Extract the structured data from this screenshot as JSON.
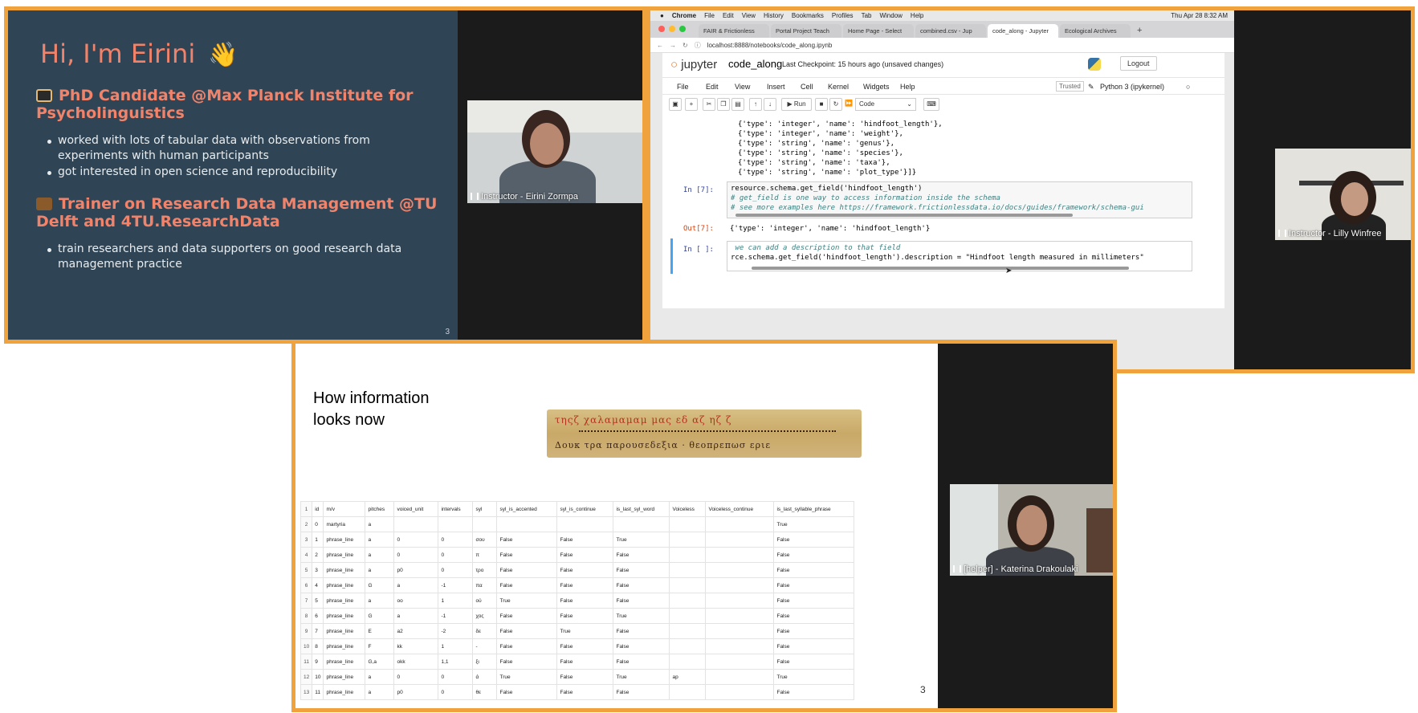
{
  "panel1": {
    "greeting": "Hi, I'm Eirini",
    "wave_emoji": "👋",
    "heading1": "PhD Candidate @Max Planck Institute for Psycholinguistics",
    "bullets1": [
      "worked with lots of tabular data with observations from experiments with human participants",
      "got interested in open science and reproducibility"
    ],
    "heading2": "Trainer on Research Data Management @TU Delft and 4TU.ResearchData",
    "bullets2": [
      "train researchers and data supporters on good research data management practice"
    ],
    "slide_number": "3",
    "video_label": "Instructor - Eirini Zormpa"
  },
  "panel2": {
    "mac_menu": [
      "Chrome",
      "File",
      "Edit",
      "View",
      "History",
      "Bookmarks",
      "Profiles",
      "Tab",
      "Window",
      "Help"
    ],
    "clock": "Thu Apr 28  8:32 AM",
    "tabs": [
      "FAIR & Frictionless",
      "Portal Project Teach",
      "Home Page - Select",
      "combined.csv - Jup",
      "code_along - Jupyter",
      "Ecological Archives"
    ],
    "active_tab": 4,
    "url": "localhost:8888/notebooks/code_along.ipynb",
    "jupyter_logo": "jupyter",
    "notebook_name": "code_along",
    "checkpoint": "Last Checkpoint: 15 hours ago  (unsaved changes)",
    "logout": "Logout",
    "menus": [
      "File",
      "Edit",
      "View",
      "Insert",
      "Cell",
      "Kernel",
      "Widgets",
      "Help"
    ],
    "trusted": "Trusted",
    "kernel": "Python 3 (ipykernel)",
    "run_label": "Run",
    "cell_type": "Code",
    "schema_lines": [
      "{'type': 'integer', 'name': 'hindfoot_length'},",
      "{'type': 'integer', 'name': 'weight'},",
      "{'type': 'string', 'name': 'genus'},",
      "{'type': 'string', 'name': 'species'},",
      "{'type': 'string', 'name': 'taxa'},",
      "{'type': 'string', 'name': 'plot_type'}]}"
    ],
    "in7_prompt": "In [7]:",
    "in7_code": "resource.schema.get_field('hindfoot_length')",
    "in7_comment1": "# get_field is one way to access information inside the schema",
    "in7_comment2": "# see more examples here https://framework.frictionlessdata.io/docs/guides/framework/schema-gui",
    "out7_prompt": "Out[7]:",
    "out7_value": "{'type': 'integer', 'name': 'hindfoot_length'}",
    "in_empty_prompt": "In [ ]:",
    "in_empty_comment": " we can add a description to that field",
    "in_empty_code": "rce.schema.get_field('hindfoot_length').description = \"Hindfoot length measured in millimeters\"",
    "video_label": "Instructor - Lilly Winfree"
  },
  "panel3": {
    "title_line1": "How information",
    "title_line2": "looks now",
    "manuscript_line1": "τηςζ χαλαμαμαμ μας  εδ αζ  ηζ ζ",
    "manuscript_line2": "Δουκ τρα παρουσεδεξια · θεοπρεπωσ εριε",
    "table_headers": [
      "",
      "id",
      "m/v",
      "pitches",
      "voiced_unit",
      "intervals",
      "syl",
      "syl_is_accented",
      "syl_is_continue",
      "is_last_syl_word",
      "Voiceless",
      "Voiceless_continue",
      "is_last_syllable_phrase"
    ],
    "table_rows": [
      [
        "2",
        "0",
        "martyria",
        "a",
        "",
        "",
        "",
        "",
        "",
        "",
        "",
        "",
        "True"
      ],
      [
        "3",
        "1",
        "phrase_line",
        "a",
        "0",
        "0",
        "σου",
        "False",
        "False",
        "True",
        "",
        "",
        "False"
      ],
      [
        "4",
        "2",
        "phrase_line",
        "a",
        "0",
        "0",
        "π",
        "False",
        "False",
        "False",
        "",
        "",
        "False"
      ],
      [
        "5",
        "3",
        "phrase_line",
        "a",
        "p0",
        "0",
        "τρο",
        "False",
        "False",
        "False",
        "",
        "",
        "False"
      ],
      [
        "6",
        "4",
        "phrase_line",
        "G",
        "a",
        "-1",
        "πα",
        "False",
        "False",
        "False",
        "",
        "",
        "False"
      ],
      [
        "7",
        "5",
        "phrase_line",
        "a",
        "oo",
        "1",
        "ού",
        "True",
        "False",
        "False",
        "",
        "",
        "False"
      ],
      [
        "8",
        "6",
        "phrase_line",
        "G",
        "a",
        "-1",
        "χος",
        "False",
        "False",
        "True",
        "",
        "",
        "False"
      ],
      [
        "9",
        "7",
        "phrase_line",
        "E",
        "a2",
        "-2",
        "δε",
        "False",
        "True",
        "False",
        "",
        "",
        "False"
      ],
      [
        "10",
        "8",
        "phrase_line",
        "F",
        "kk",
        "1",
        "-",
        "False",
        "False",
        "False",
        "",
        "",
        "False"
      ],
      [
        "11",
        "9",
        "phrase_line",
        "G,a",
        "okk",
        "1,1",
        "ξι",
        "False",
        "False",
        "False",
        "",
        "",
        "False"
      ],
      [
        "12",
        "10",
        "phrase_line",
        "a",
        "0",
        "0",
        "ά",
        "True",
        "False",
        "True",
        "ap",
        "",
        "True"
      ],
      [
        "13",
        "11",
        "phrase_line",
        "a",
        "p0",
        "0",
        "θε",
        "False",
        "False",
        "False",
        "",
        "",
        "False"
      ]
    ],
    "table_header_rownum": "1",
    "slide_number": "3",
    "video_label": "[helper] - Katerina Drakoulaki"
  }
}
